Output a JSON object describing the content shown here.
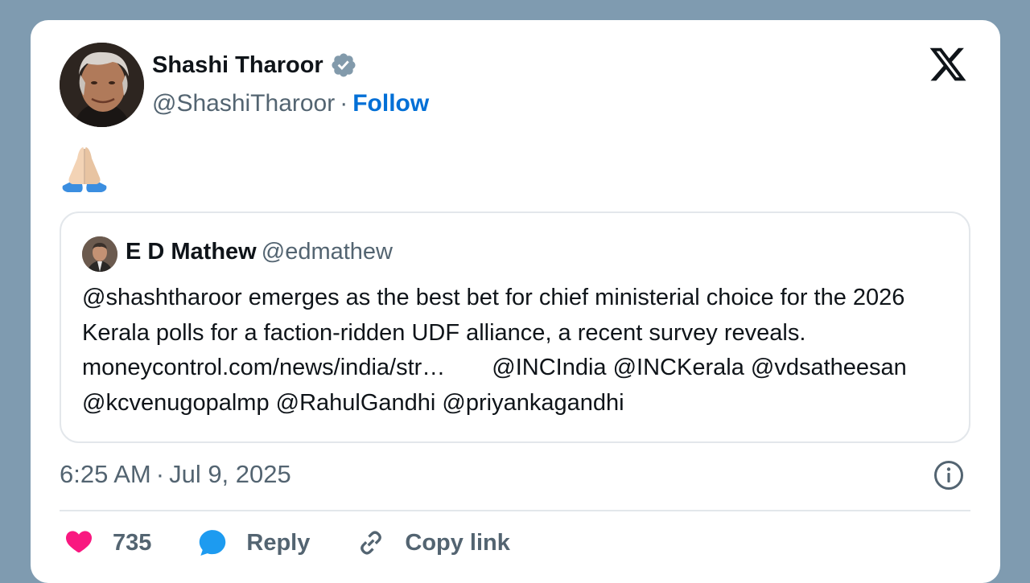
{
  "author": {
    "name": "Shashi Tharoor",
    "handle": "@ShashiTharoor",
    "separator": "·",
    "follow_label": "Follow"
  },
  "tweet": {
    "emoji": "🙏🏻"
  },
  "quoted": {
    "name": "E D Mathew",
    "handle": "@edmathew",
    "text_part1": "@shashtharoor emerges as the best bet for chief ministerial choice for the 2026 Kerala polls for a faction-ridden UDF alliance, a recent survey reveals. moneycontrol.com/news/india/str…",
    "text_part2": "@INCIndia @INCKerala @vdsatheesan @kcvenugopalmp @RahulGandhi @priyankagandhi"
  },
  "meta": {
    "time": "6:25 AM",
    "separator": "·",
    "date": "Jul 9, 2025"
  },
  "actions": {
    "like_count": "735",
    "reply_label": "Reply",
    "copy_label": "Copy link"
  },
  "icons": {
    "logo": "x-logo-icon",
    "verified": "verified-badge-icon",
    "info": "info-icon",
    "like": "heart-icon",
    "reply": "reply-bubble-icon",
    "copy": "link-icon"
  },
  "colors": {
    "background": "#7f9bb0",
    "card": "#ffffff",
    "text": "#0f1419",
    "muted": "#536471",
    "follow": "#006fd6",
    "verified": "#829aab",
    "heart": "#f91880",
    "reply": "#1d9bf0",
    "border": "#e3e7eb"
  }
}
